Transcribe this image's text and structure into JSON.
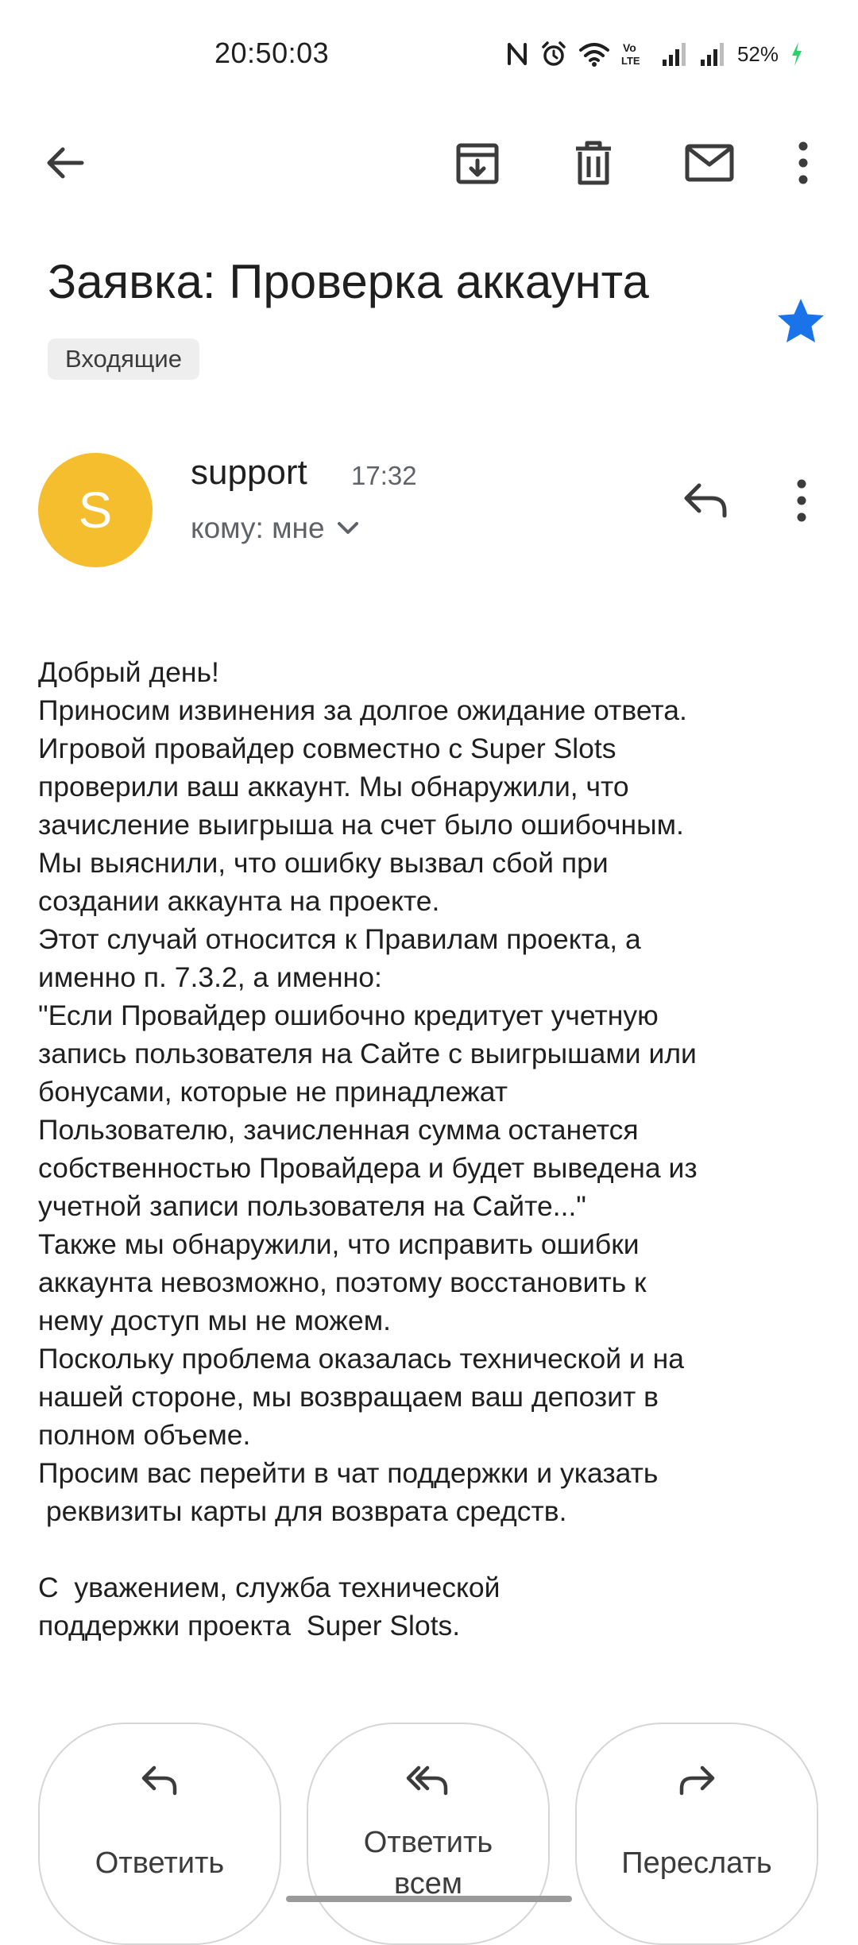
{
  "status_bar": {
    "time": "20:50:03",
    "battery": "52%"
  },
  "email": {
    "subject": "Заявка: Проверка аккаунта",
    "label": "Входящие",
    "starred": true,
    "sender": {
      "initial": "S",
      "name": "support",
      "time": "17:32",
      "recipient": "кому: мне",
      "avatar_color": "#f4be2f"
    },
    "body_lines": [
      "Добрый день!",
      "Приносим извинения за долгое ожидание ответа.",
      "Игровой провайдер совместно с Super Slots",
      "проверили ваш аккаунт. Мы обнаружили, что",
      "зачисление выигрыша на счет было ошибочным.",
      "Мы выяснили, что ошибку вызвал сбой при",
      "создании аккаунта на проекте.",
      "Этот случай относится к Правилам проекта, а",
      "именно п. 7.3.2, а именно:",
      "\"Если Провайдер ошибочно кредитует учетную",
      "запись пользователя на Сайте с выигрышами или",
      "бонусами, которые не принадлежат",
      "Пользователю, зачисленная сумма останется",
      "собственностью Провайдера и будет выведена из",
      "учетной записи пользователя на Сайте...\"",
      "Также мы обнаружили, что исправить ошибки",
      "аккаунта невозможно, поэтому восстановить к",
      "нему доступ мы не можем.",
      "Поскольку проблема оказалась технической и на",
      "нашей стороне, мы возвращаем ваш депозит в",
      "полном объеме.",
      "Просим вас перейти в чат поддержки и указать",
      " реквизиты карты для возврата средств.",
      "",
      "С  уважением, служба технической",
      "поддержки проекта  Super Slots."
    ]
  },
  "actions": {
    "reply": "Ответить",
    "reply_all_line1": "Ответить",
    "reply_all_line2": "всем",
    "forward": "Переслать"
  },
  "colors": {
    "star": "#1a73e8",
    "avatar": "#f4be2f",
    "text": "#1f1f1f",
    "secondary_text": "#5f6368"
  }
}
